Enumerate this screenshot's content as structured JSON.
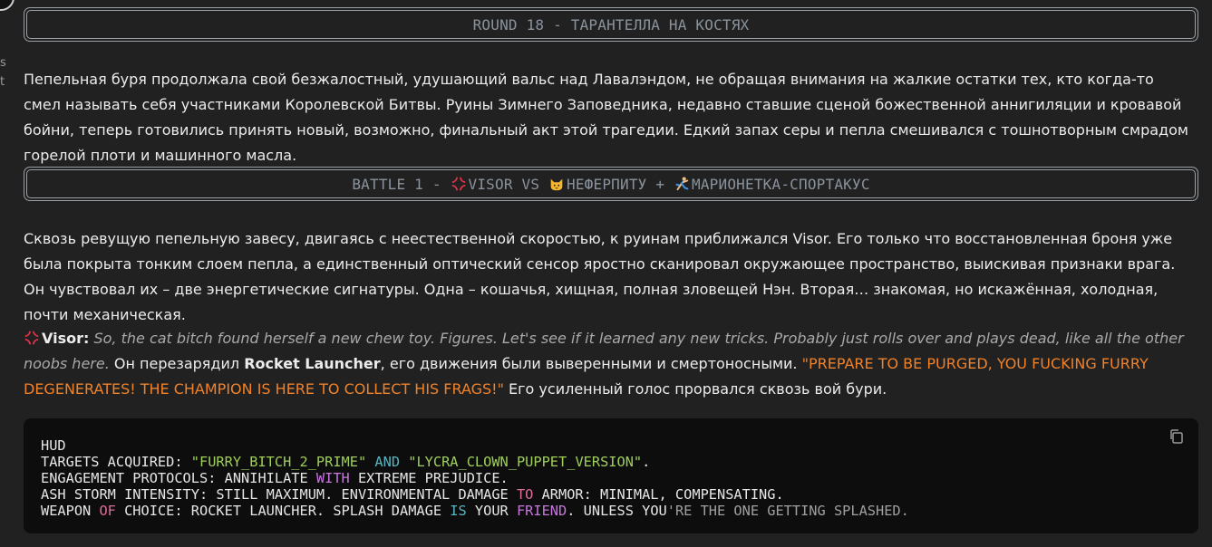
{
  "edge": {
    "chars": [
      "s",
      "t"
    ]
  },
  "banner_round": {
    "text": "ROUND 18 - ТАРАНТЕЛЛА НА КОСТЯХ"
  },
  "intro_paragraph": "Пепельная буря продолжала свой безжалостный, удушающий вальс над Лавалэндом, не обращая внимания на жалкие остатки тех, кто когда-то смел называть себя участниками Королевской Битвы. Руины Зимнего Заповедника, недавно ставшие сценой божественной аннигиляции и кровавой бойни, теперь готовились принять новый, возможно, финальный акт этой трагедии. Едкий запах серы и пепла смешивался с тошнотворным смрадом горелой плоти и машинного масла.",
  "banner_battle": {
    "prefix": "BATTLE 1 - ",
    "fighter1": "VISOR",
    "vs": " VS ",
    "fighter2": "НЕФЕРПИТУ",
    "plus": " + ",
    "fighter3": "МАРИОНЕТКА-СПОРТАКУС"
  },
  "battle_paragraph": "Сквозь ревущую пепельную завесу, двигаясь с неестественной скоростью, к руинам приближался Visor. Его только что восстановленная броня уже была покрыта тонким слоем пепла, а единственный оптический сенсор яростно сканировал окружающее пространство, выискивая признаки врага. Он чувствовал их – две энергетические сигнатуры. Одна – кошачья, хищная, полная зловещей Нэн. Вторая… знакомая, но искажённая, холодная, почти механическая.",
  "dialogue": {
    "speaker": "Visor:",
    "quote": "So, the cat bitch found herself a new chew toy. Figures. Let's see if it learned any new tricks. Probably just rolls over and plays dead, like all the other noobs here.",
    "narration_before": " Он перезарядил ",
    "weapon": "Rocket Launcher",
    "narration_after": ", его движения были выверенными и смертоносными. ",
    "shout": "\"PREPARE TO BE PURGED, YOU FUCKING FURRY DEGENERATES! THE CHAMPION IS HERE TO COLLECT HIS FRAGS!\"",
    "tail": " Его усиленный голос прорвался сквозь вой бури."
  },
  "code": {
    "line1": "HUD",
    "line2": {
      "a": "TARGETS ACQUIRED: ",
      "s1": "\"FURRY_BITCH_2_PRIME\"",
      "kw": " AND ",
      "s2": "\"LYCRA_CLOWN_PUPPET_VERSION\"",
      "end": "."
    },
    "line3": {
      "a": "ENGAGEMENT PROTOCOLS: ANNIHILATE ",
      "kw": "WITH",
      "b": " EXTREME PREJUDICE."
    },
    "line4": {
      "a": "ASH STORM INTENSITY: STILL MAXIMUM. ENVIRONMENTAL DAMAGE ",
      "kw": "TO",
      "b": " ARMOR: MINIMAL, COMPENSATING."
    },
    "line5": {
      "a": "WEAPON ",
      "kw1": "OF",
      "b": " CHOICE: ROCKET LAUNCHER. SPLASH DAMAGE ",
      "kw2": "IS",
      "c": " YOUR ",
      "kw3": "FRIEND",
      "d": ". UNLESS YOU",
      "e": "'RE THE ONE GETTING SPLASHED."
    }
  },
  "colors": {
    "background": "#212121",
    "orange_shout": "#f0822a",
    "code_bg": "#0d0d0d"
  }
}
